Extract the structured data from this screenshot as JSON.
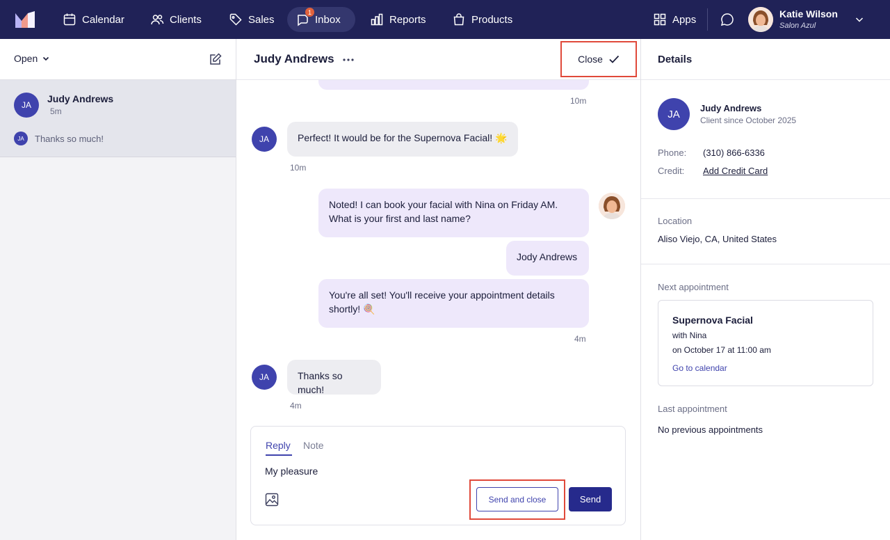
{
  "nav": {
    "items": [
      {
        "label": "Calendar",
        "icon": "calendar-icon"
      },
      {
        "label": "Clients",
        "icon": "clients-icon"
      },
      {
        "label": "Sales",
        "icon": "tag-icon"
      },
      {
        "label": "Inbox",
        "icon": "inbox-icon",
        "badge": "1"
      },
      {
        "label": "Reports",
        "icon": "bar-chart-icon"
      },
      {
        "label": "Products",
        "icon": "shopping-bag-icon"
      }
    ],
    "apps_label": "Apps",
    "user": {
      "name": "Katie Wilson",
      "business": "Salon Azul"
    }
  },
  "inbox": {
    "filter_label": "Open",
    "conversations": [
      {
        "initials": "JA",
        "name": "Judy Andrews",
        "time": "5m",
        "preview": "Thanks so much!"
      }
    ]
  },
  "conversation": {
    "title": "Judy Andrews",
    "close_label": "Close",
    "messages": [
      {
        "text": "Perfect! It would be for the Supernova Facial! 🌟",
        "time": "10m",
        "top_time": "10m",
        "initials": "JA"
      },
      {
        "text": "Noted! I can book your facial with Nina on Friday AM. What is your first and last name?"
      },
      {
        "text": "Jody Andrews"
      },
      {
        "text": "You're all set! You'll receive your appointment details shortly! 🍭",
        "time": "4m"
      },
      {
        "text": "Thanks so much!",
        "time": "4m",
        "initials": "JA"
      }
    ],
    "composer": {
      "tab_reply": "Reply",
      "tab_note": "Note",
      "value": "My pleasure",
      "send_and_close": "Send and close",
      "send": "Send"
    }
  },
  "details": {
    "title": "Details",
    "client": {
      "initials": "JA",
      "name": "Judy Andrews",
      "since": "Client since October 2025",
      "phone_label": "Phone:",
      "phone": "(310) 866-6336",
      "credit_label": "Credit:",
      "credit_action": "Add Credit Card"
    },
    "location": {
      "label": "Location",
      "value": "Aliso Viejo, CA, United States"
    },
    "next_appointment": {
      "label": "Next appointment",
      "service": "Supernova Facial",
      "staff": "with Nina",
      "when": "on October 17 at 11:00 am",
      "link": "Go to calendar"
    },
    "last_appointment": {
      "label": "Last appointment",
      "value": "No previous appointments"
    }
  },
  "colors": {
    "nav_bg": "#202257",
    "accent": "#3f43ad",
    "highlight": "#e0493a",
    "badge": "#e2623c"
  }
}
